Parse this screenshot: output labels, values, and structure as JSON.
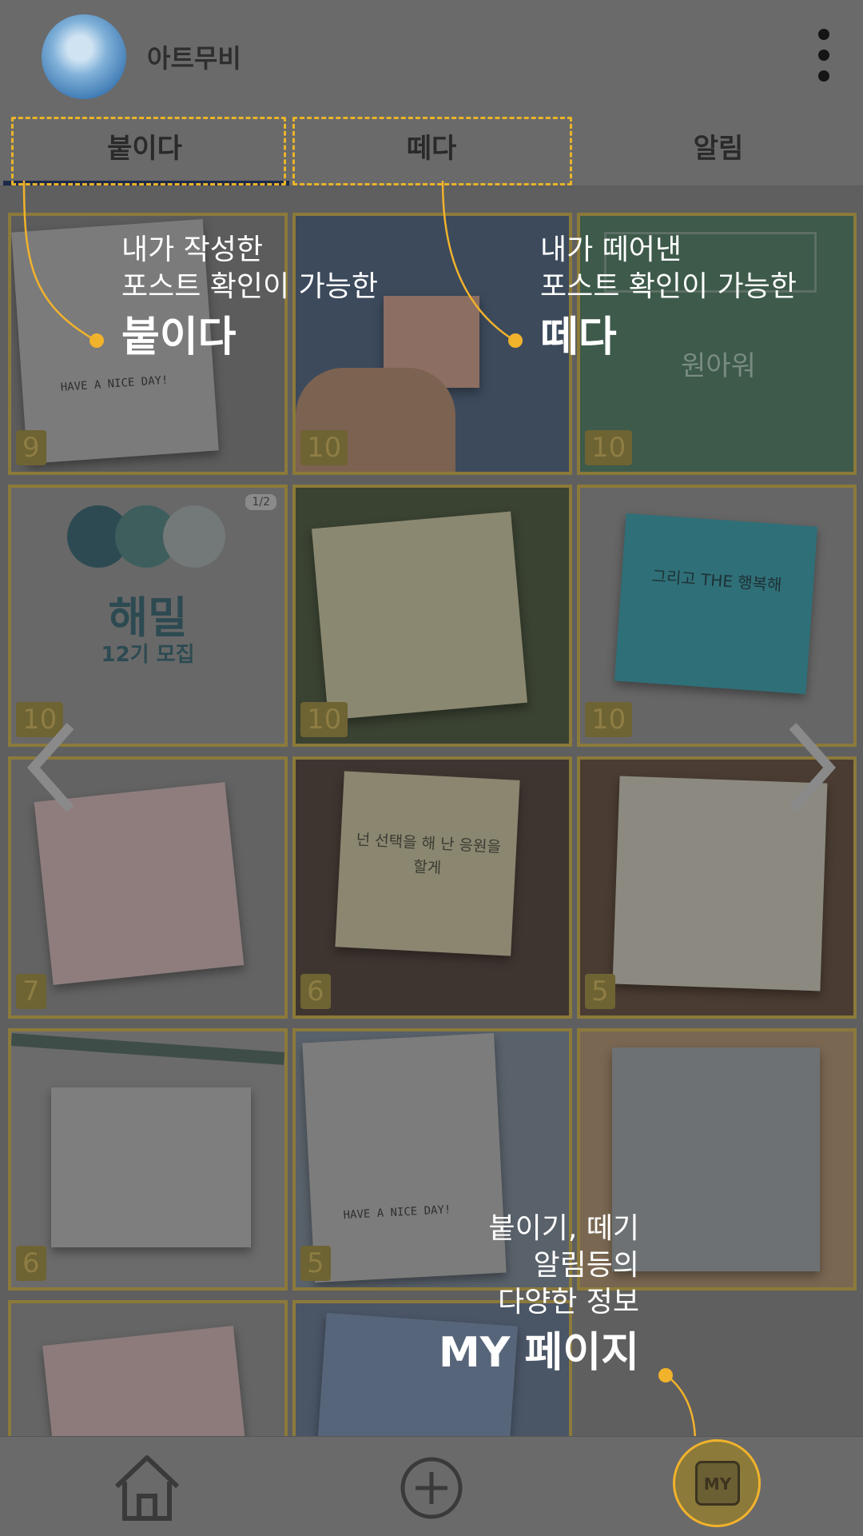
{
  "header": {
    "username": "아트무비"
  },
  "tabs": [
    {
      "label": "붙이다"
    },
    {
      "label": "떼다"
    },
    {
      "label": "알림"
    }
  ],
  "posts": [
    {
      "count": "9"
    },
    {
      "count": "10"
    },
    {
      "count": "10"
    },
    {
      "count": "10",
      "title": "해밀",
      "subtitle": "12기 모집",
      "badge": "1/2"
    },
    {
      "count": "10"
    },
    {
      "count": "10",
      "note_text": "그리고 THE 행복해"
    },
    {
      "count": "7"
    },
    {
      "count": "6",
      "note_text": "넌 선택을 해 난 응원을 할게"
    },
    {
      "count": "5"
    },
    {
      "count": "6"
    },
    {
      "count": "5",
      "note_text": "HAVE A NICE DAY!"
    },
    {
      "count": ""
    },
    {
      "count": ""
    },
    {
      "count": ""
    }
  ],
  "note0_text": "HAVE A NICE DAY!",
  "note2_text": "원아워",
  "overlay": {
    "attach": {
      "line1": "내가 작성한",
      "line2": "포스트 확인이 가능한",
      "title": "붙이다"
    },
    "detach": {
      "line1": "내가 떼어낸",
      "line2": "포스트 확인이 가능한",
      "title": "떼다"
    },
    "my": {
      "line1": "붙이기, 떼기",
      "line2": "알림등의",
      "line3": "다양한 정보",
      "title": "MY 페이지"
    }
  },
  "nav": {
    "my_label": "MY"
  },
  "colors": {
    "accent": "#f1b22c",
    "dim_overlay": "#5f5f5f"
  },
  "icons": [
    "kebab-menu-icon",
    "home-icon",
    "add-circle-icon",
    "my-page-icon",
    "chevron-left-icon",
    "chevron-right-icon"
  ]
}
